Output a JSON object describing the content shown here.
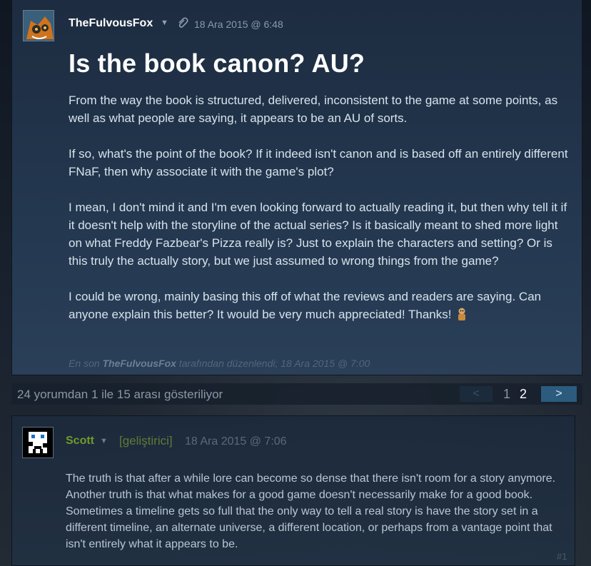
{
  "post": {
    "author": "TheFulvousFox",
    "date": "18 Ara 2015 @ 6:48",
    "title": "Is the book canon? AU?",
    "paragraphs": [
      "From the way the book is structured, delivered, inconsistent to the game at some points, as well as what people are saying, it appears to be an AU of sorts.",
      "If so, what's the point of the book? If it indeed isn't canon and is based off an entirely different FNaF, then why associate it with the game's plot?",
      "I mean, I don't mind it and I'm even looking forward to actually reading it, but then why tell it if it doesn't help with the storyline of the actual series? Is it basically meant to shed more light on what Freddy Fazbear's Pizza really is? Just to explain the characters and setting? Or is this truly the actually story, but we just assumed to wrong things from the game?",
      "I could be wrong, mainly basing this off of what the reviews and readers are saying. Can anyone explain this better? It would be very much appreciated! Thanks!"
    ],
    "edited_prefix": "En son",
    "edited_author": "TheFulvousFox",
    "edited_suffix": "tarafından düzenlendi; 18 Ara 2015 @ 7:00"
  },
  "pager": {
    "summary": "24 yorumdan 1 ile 15 arası gösteriliyor",
    "prev": "<",
    "pages": [
      "1",
      "2"
    ],
    "next": ">"
  },
  "comment": {
    "author": "Scott",
    "badge": "[geliştirici]",
    "date": "18 Ara 2015 @ 7:06",
    "text": "The truth is that after a while lore can become so dense that there isn't room for a story anymore. Another truth is that what makes for a good game doesn't necessarily make for a good book. Sometimes a timeline gets so full that the only way to tell a real story is have the story set in a different timeline, an alternate universe, a different location, or perhaps from a vantage point that isn't entirely what it appears to be.",
    "number": "#1"
  },
  "colors": {
    "background": "#1b2838",
    "developer_name": "#6f9a2a",
    "next_button": "#2c5b7e"
  },
  "icons": [
    "avatar-fox",
    "caret-down-icon",
    "paperclip-icon",
    "emoji-icon",
    "avatar-pixel"
  ]
}
